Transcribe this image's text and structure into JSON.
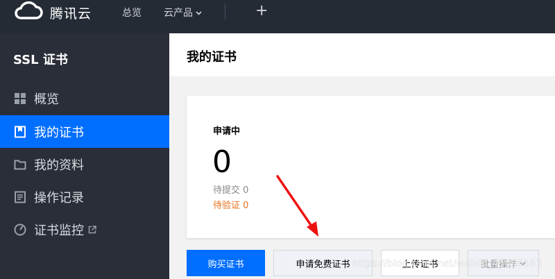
{
  "topbar": {
    "brand": "腾讯云",
    "nav": {
      "overview": "总览",
      "products": "云产品"
    },
    "plus": "+"
  },
  "sidebar": {
    "title": "SSL 证书",
    "items": [
      {
        "label": "概览",
        "icon": "grid-icon"
      },
      {
        "label": "我的证书",
        "icon": "certificate-icon",
        "active": true
      },
      {
        "label": "我的资料",
        "icon": "folder-icon"
      },
      {
        "label": "操作记录",
        "icon": "log-icon"
      },
      {
        "label": "证书监控",
        "icon": "monitor-icon",
        "external": true
      }
    ]
  },
  "main": {
    "title": "我的证书",
    "card": {
      "label": "申请中",
      "count": "0",
      "pending": "待提交 0",
      "verifying": "待验证 0"
    },
    "buttons": {
      "buy": "购买证书",
      "free": "申请免费证书",
      "upload": "上传证书",
      "batch": "批量操作"
    }
  },
  "watermark": "https://blog.csdn.net/weixin_45056163",
  "colors": {
    "topbar_bg": "#252b35",
    "sidebar_bg": "#292e38",
    "accent": "#006eff",
    "warning": "#e86f1a",
    "annotation": "#ee1111"
  }
}
